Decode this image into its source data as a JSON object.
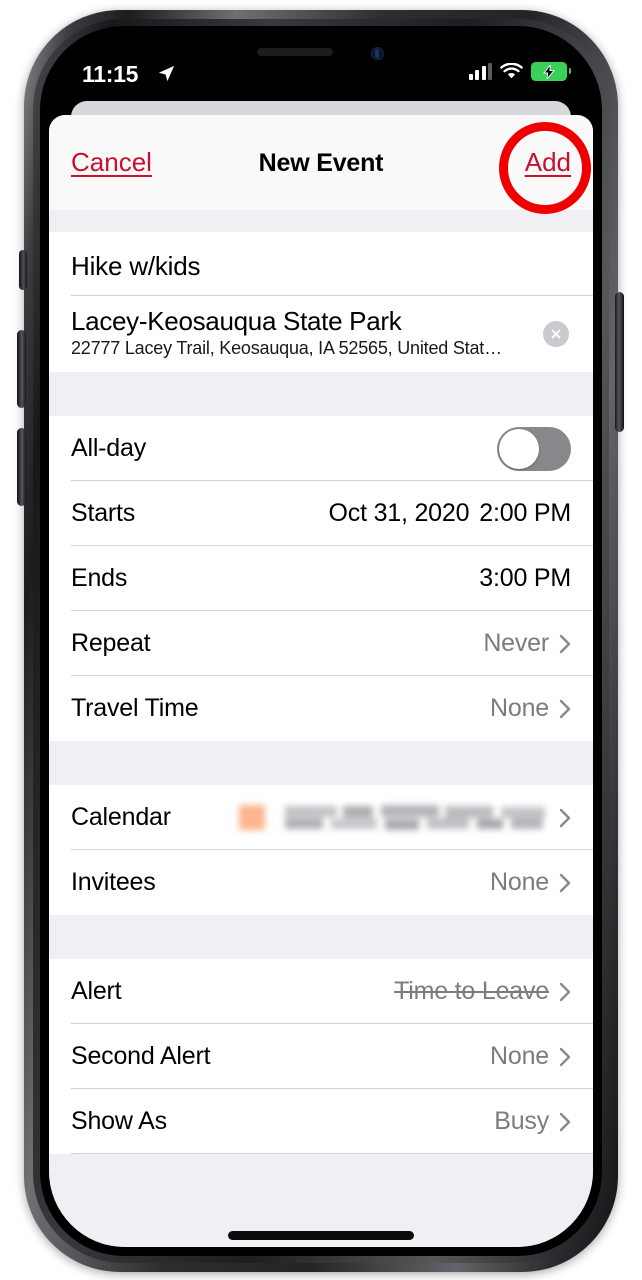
{
  "status_bar": {
    "time": "11:15",
    "location_icon": "location-arrow-icon",
    "cellular_icon": "cellular-signal-icon",
    "wifi_icon": "wifi-icon",
    "battery_icon": "battery-charging-icon",
    "battery_color": "#3ad15a"
  },
  "navbar": {
    "cancel_label": "Cancel",
    "title": "New Event",
    "add_label": "Add",
    "accent_color": "#c8102e"
  },
  "annotation": {
    "shape": "circle",
    "target": "Add",
    "color": "#ee0000"
  },
  "form": {
    "title_value": "Hike w/kids",
    "location": {
      "name": "Lacey-Keosauqua State Park",
      "address": "22777 Lacey Trail, Keosauqua, IA  52565, United Stat…",
      "clear_icon": "clear-circle-icon"
    },
    "all_day": {
      "label": "All-day",
      "value": "off"
    },
    "starts": {
      "label": "Starts",
      "date": "Oct 31, 2020",
      "time": "2:00 PM"
    },
    "ends": {
      "label": "Ends",
      "date": "",
      "time": "3:00 PM"
    },
    "repeat": {
      "label": "Repeat",
      "value": "Never"
    },
    "travel_time": {
      "label": "Travel Time",
      "value": "None"
    },
    "calendar": {
      "label": "Calendar",
      "value": "",
      "redacted": true,
      "swatch_color": "#fbb68d"
    },
    "invitees": {
      "label": "Invitees",
      "value": "None"
    },
    "alert": {
      "label": "Alert",
      "value": "Time to Leave",
      "struck_through": true
    },
    "second_alert": {
      "label": "Second Alert",
      "value": "None"
    },
    "show_as": {
      "label": "Show As",
      "value": "Busy"
    }
  },
  "home_indicator": "home-indicator-bar"
}
